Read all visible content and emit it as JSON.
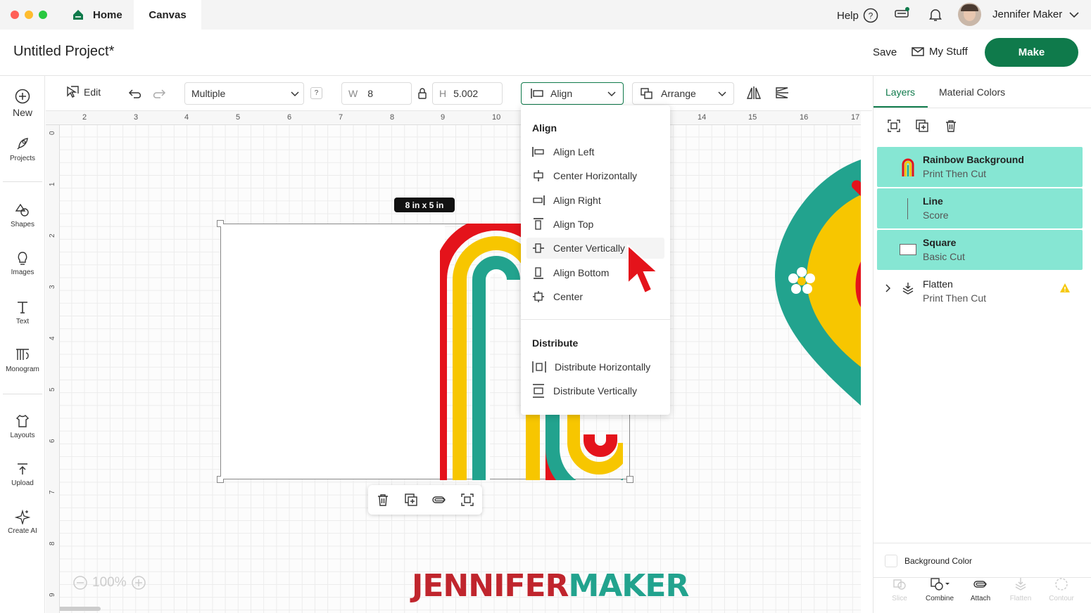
{
  "tabs": {
    "home": "Home",
    "canvas": "Canvas"
  },
  "topbar": {
    "help": "Help",
    "user_name": "Jennifer Maker"
  },
  "header": {
    "project_title": "Untitled Project*",
    "save": "Save",
    "my_stuff": "My Stuff",
    "make": "Make"
  },
  "sidebar": [
    {
      "label": "New",
      "icon": "plus-circle-icon"
    },
    {
      "label": "Projects",
      "icon": "rocket-icon"
    },
    {
      "label": "Shapes",
      "icon": "shapes-icon"
    },
    {
      "label": "Images",
      "icon": "lightbulb-icon"
    },
    {
      "label": "Text",
      "icon": "text-icon"
    },
    {
      "label": "Monogram",
      "icon": "monogram-icon"
    },
    {
      "label": "Layouts",
      "icon": "tshirt-icon"
    },
    {
      "label": "Upload",
      "icon": "upload-icon"
    },
    {
      "label": "Create AI",
      "icon": "sparkle-icon"
    }
  ],
  "toolbar": {
    "edit": "Edit",
    "operation": "Multiple",
    "help_badge": "?",
    "w_label": "W",
    "w_value": "8",
    "h_label": "H",
    "h_value": "5.002",
    "align": "Align",
    "arrange": "Arrange"
  },
  "rulers": {
    "top": [
      "2",
      "3",
      "4",
      "5",
      "6",
      "7",
      "8",
      "9",
      "10",
      "14",
      "15",
      "16",
      "17"
    ],
    "left": [
      "0",
      "1",
      "2",
      "3",
      "4",
      "5",
      "6",
      "7",
      "8",
      "9"
    ]
  },
  "canvas": {
    "size_badge": "8  in x 5  in",
    "zoom": "100%",
    "watermark_a": "JENNIFER",
    "watermark_b": "MAKER"
  },
  "align_menu": {
    "align_heading": "Align",
    "items": [
      "Align Left",
      "Center Horizontally",
      "Align Right",
      "Align Top",
      "Center Vertically",
      "Align Bottom",
      "Center"
    ],
    "distribute_heading": "Distribute",
    "distribute_items": [
      "Distribute Horizontally",
      "Distribute Vertically"
    ]
  },
  "right_panel": {
    "tabs": [
      "Layers",
      "Material Colors"
    ],
    "layers": [
      {
        "name": "Rainbow Background",
        "type": "Print Then Cut"
      },
      {
        "name": "Line",
        "type": "Score"
      },
      {
        "name": "Square",
        "type": "Basic Cut"
      },
      {
        "name": "Flatten",
        "type": "Print Then Cut"
      }
    ],
    "background_color": "Background Color",
    "bottom_tools": [
      "Slice",
      "Combine",
      "Attach",
      "Flatten",
      "Contour"
    ]
  },
  "colors": {
    "brand_green": "#0f7a4b",
    "layer_highlight": "#86e6d3",
    "rainbow_red": "#e4131b",
    "rainbow_yellow": "#f7c600",
    "rainbow_teal": "#22a38e",
    "accent_blue": "#0f7a4b"
  }
}
